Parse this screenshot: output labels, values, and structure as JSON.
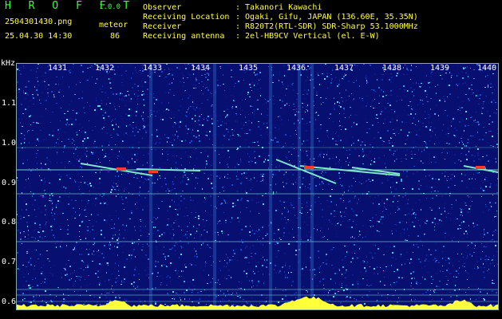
{
  "app": {
    "logo": "H R O F F T",
    "version": "1.0.0"
  },
  "file": {
    "name": "2504301430.png",
    "datetime": "25.04.30 14:30",
    "mode": "meteor",
    "count": "86"
  },
  "info": [
    {
      "label": "Observer",
      "value": ": Takanori Kawachi"
    },
    {
      "label": "Receiving Location",
      "value": ": Ogaki, Gifu, JAPAN (136.60E, 35.35N)"
    },
    {
      "label": "Receiver",
      "value": ": R820T2(RTL-SDR) SDR-Sharp 53.1000MHz"
    },
    {
      "label": "Receiving antenna",
      "value": ": 2el-HB9CV Vertical (el. E-W)"
    }
  ],
  "axis": {
    "unit": "kHz",
    "x_ticks": [
      "1431",
      "1432",
      "1433",
      "1434",
      "1435",
      "1436",
      "1437",
      "1438",
      "1439",
      "1440"
    ],
    "y_ticks": [
      "1.1",
      "1.0",
      "0.9",
      "0.8",
      "0.7",
      "0.6"
    ]
  },
  "colors": {
    "background": "#000000",
    "spectrum": "#071070",
    "header_green": "#38ff38",
    "header_yellow": "#ffff3a",
    "trace": "#7fe6c7",
    "hot": "#ff3a2a"
  }
}
